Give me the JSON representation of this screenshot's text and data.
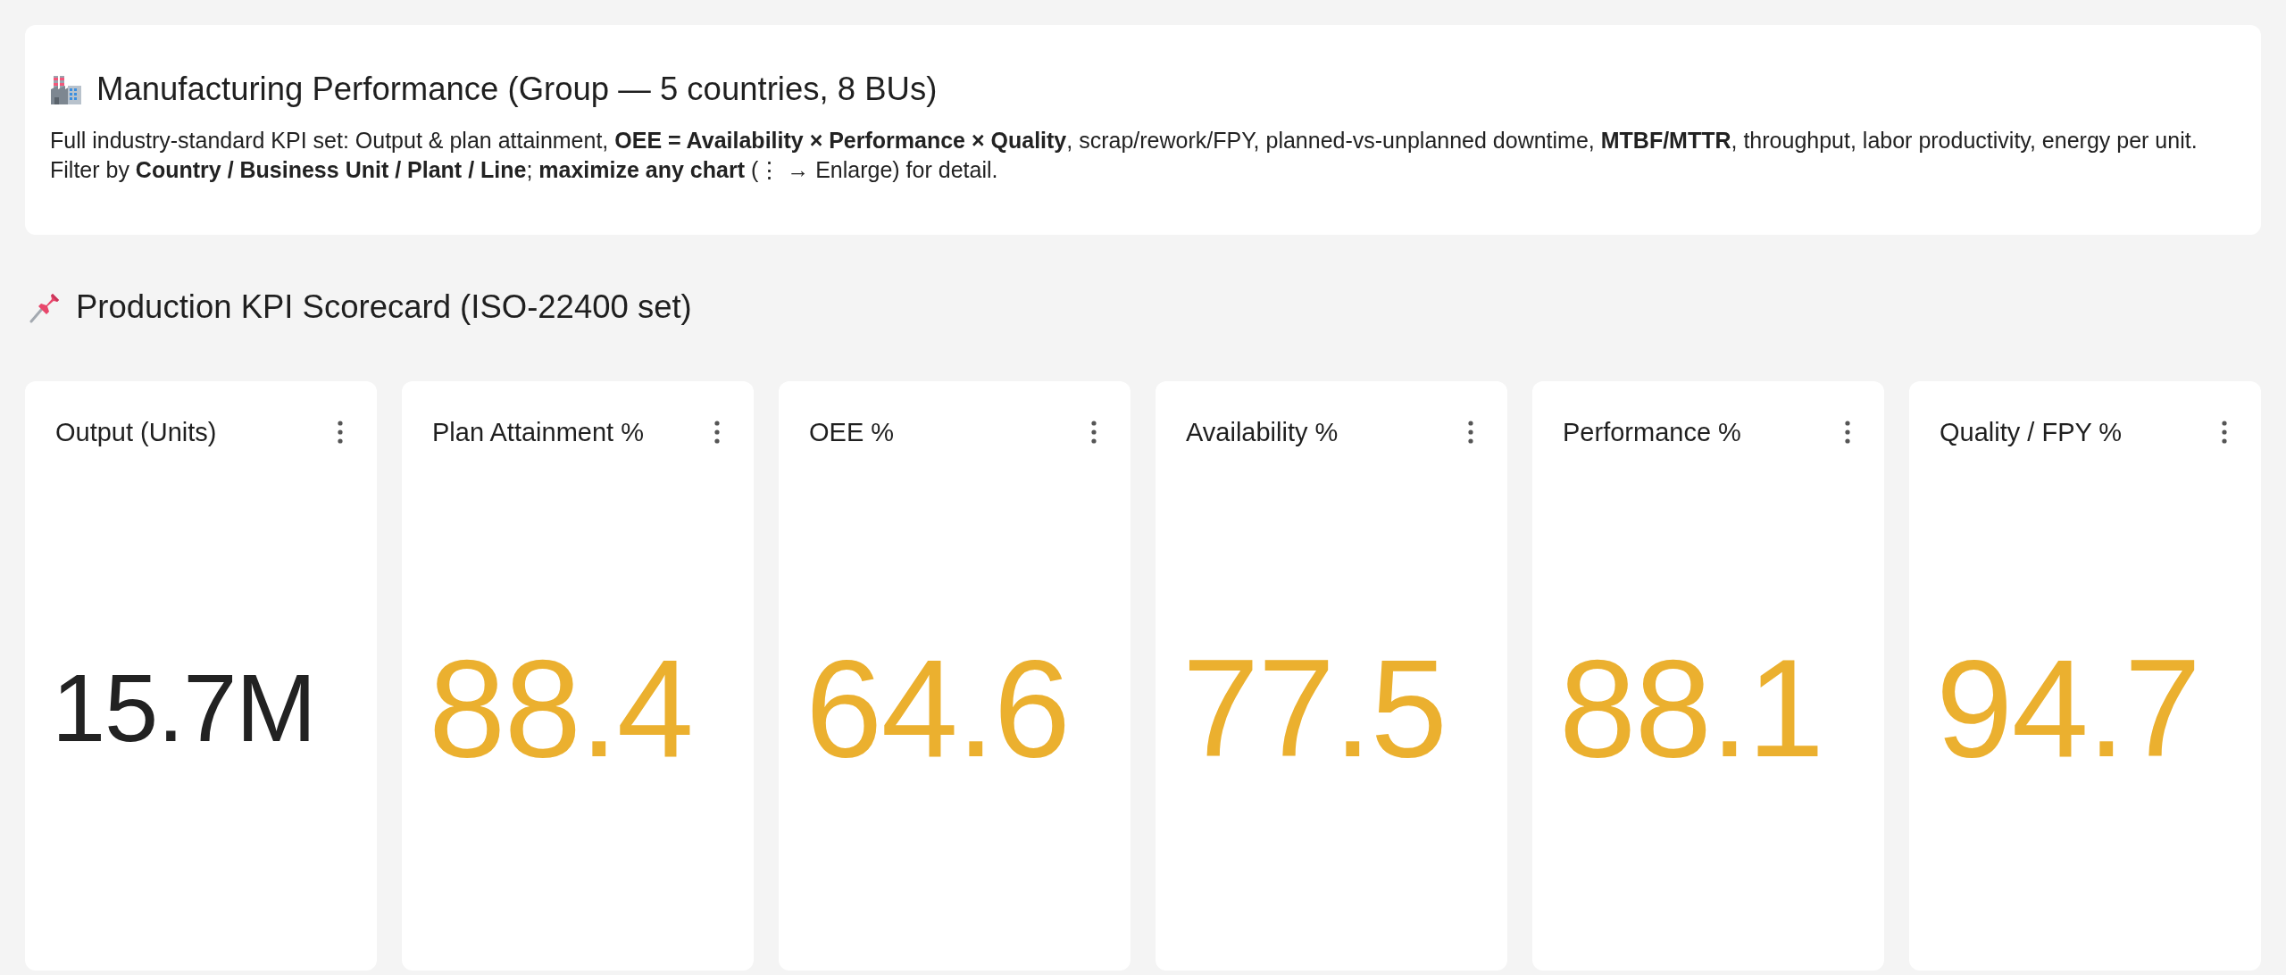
{
  "header": {
    "title": "Manufacturing Performance (Group — 5 countries, 8 BUs)",
    "description": [
      "Full industry-standard KPI set: Output & plan attainment, **OEE = Availability × Performance × Quality**, scrap/rework/FPY, planned-vs-unplanned downtime, **MTBF/MTTR**, throughput, labor productivity, energy per unit.",
      "Filter by **Country / Business Unit / Plant / Line**; **maximize any chart** (⋮ → Enlarge) for detail."
    ]
  },
  "section": {
    "title": "Production KPI Scorecard (ISO-22400 set)"
  },
  "kpi_cards": [
    {
      "title": "Output (Units)",
      "value": "15.7M",
      "color": "#222222"
    },
    {
      "title": "Plan Attainment %",
      "value": "88.4",
      "color": "#ebb02f"
    },
    {
      "title": "OEE %",
      "value": "64.6",
      "color": "#ebb02f"
    },
    {
      "title": "Availability %",
      "value": "77.5",
      "color": "#ebb02f"
    },
    {
      "title": "Performance %",
      "value": "88.1",
      "color": "#ebb02f"
    },
    {
      "title": "Quality / FPY %",
      "value": "94.7",
      "color": "#ebb02f"
    }
  ]
}
